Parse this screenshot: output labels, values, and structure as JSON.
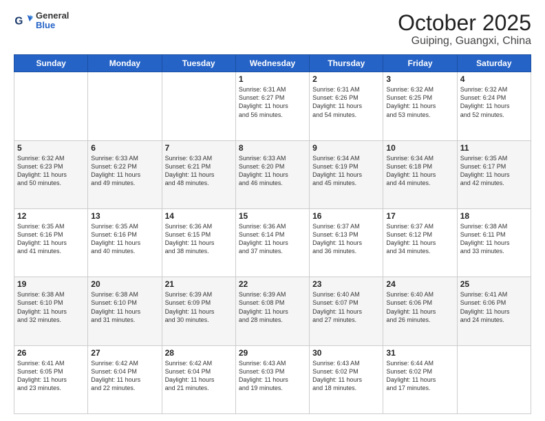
{
  "logo": {
    "line1": "General",
    "line2": "Blue"
  },
  "title": "October 2025",
  "subtitle": "Guiping, Guangxi, China",
  "days_of_week": [
    "Sunday",
    "Monday",
    "Tuesday",
    "Wednesday",
    "Thursday",
    "Friday",
    "Saturday"
  ],
  "weeks": [
    [
      {
        "day": "",
        "info": ""
      },
      {
        "day": "",
        "info": ""
      },
      {
        "day": "",
        "info": ""
      },
      {
        "day": "1",
        "info": "Sunrise: 6:31 AM\nSunset: 6:27 PM\nDaylight: 11 hours\nand 56 minutes."
      },
      {
        "day": "2",
        "info": "Sunrise: 6:31 AM\nSunset: 6:26 PM\nDaylight: 11 hours\nand 54 minutes."
      },
      {
        "day": "3",
        "info": "Sunrise: 6:32 AM\nSunset: 6:25 PM\nDaylight: 11 hours\nand 53 minutes."
      },
      {
        "day": "4",
        "info": "Sunrise: 6:32 AM\nSunset: 6:24 PM\nDaylight: 11 hours\nand 52 minutes."
      }
    ],
    [
      {
        "day": "5",
        "info": "Sunrise: 6:32 AM\nSunset: 6:23 PM\nDaylight: 11 hours\nand 50 minutes."
      },
      {
        "day": "6",
        "info": "Sunrise: 6:33 AM\nSunset: 6:22 PM\nDaylight: 11 hours\nand 49 minutes."
      },
      {
        "day": "7",
        "info": "Sunrise: 6:33 AM\nSunset: 6:21 PM\nDaylight: 11 hours\nand 48 minutes."
      },
      {
        "day": "8",
        "info": "Sunrise: 6:33 AM\nSunset: 6:20 PM\nDaylight: 11 hours\nand 46 minutes."
      },
      {
        "day": "9",
        "info": "Sunrise: 6:34 AM\nSunset: 6:19 PM\nDaylight: 11 hours\nand 45 minutes."
      },
      {
        "day": "10",
        "info": "Sunrise: 6:34 AM\nSunset: 6:18 PM\nDaylight: 11 hours\nand 44 minutes."
      },
      {
        "day": "11",
        "info": "Sunrise: 6:35 AM\nSunset: 6:17 PM\nDaylight: 11 hours\nand 42 minutes."
      }
    ],
    [
      {
        "day": "12",
        "info": "Sunrise: 6:35 AM\nSunset: 6:16 PM\nDaylight: 11 hours\nand 41 minutes."
      },
      {
        "day": "13",
        "info": "Sunrise: 6:35 AM\nSunset: 6:16 PM\nDaylight: 11 hours\nand 40 minutes."
      },
      {
        "day": "14",
        "info": "Sunrise: 6:36 AM\nSunset: 6:15 PM\nDaylight: 11 hours\nand 38 minutes."
      },
      {
        "day": "15",
        "info": "Sunrise: 6:36 AM\nSunset: 6:14 PM\nDaylight: 11 hours\nand 37 minutes."
      },
      {
        "day": "16",
        "info": "Sunrise: 6:37 AM\nSunset: 6:13 PM\nDaylight: 11 hours\nand 36 minutes."
      },
      {
        "day": "17",
        "info": "Sunrise: 6:37 AM\nSunset: 6:12 PM\nDaylight: 11 hours\nand 34 minutes."
      },
      {
        "day": "18",
        "info": "Sunrise: 6:38 AM\nSunset: 6:11 PM\nDaylight: 11 hours\nand 33 minutes."
      }
    ],
    [
      {
        "day": "19",
        "info": "Sunrise: 6:38 AM\nSunset: 6:10 PM\nDaylight: 11 hours\nand 32 minutes."
      },
      {
        "day": "20",
        "info": "Sunrise: 6:38 AM\nSunset: 6:10 PM\nDaylight: 11 hours\nand 31 minutes."
      },
      {
        "day": "21",
        "info": "Sunrise: 6:39 AM\nSunset: 6:09 PM\nDaylight: 11 hours\nand 30 minutes."
      },
      {
        "day": "22",
        "info": "Sunrise: 6:39 AM\nSunset: 6:08 PM\nDaylight: 11 hours\nand 28 minutes."
      },
      {
        "day": "23",
        "info": "Sunrise: 6:40 AM\nSunset: 6:07 PM\nDaylight: 11 hours\nand 27 minutes."
      },
      {
        "day": "24",
        "info": "Sunrise: 6:40 AM\nSunset: 6:06 PM\nDaylight: 11 hours\nand 26 minutes."
      },
      {
        "day": "25",
        "info": "Sunrise: 6:41 AM\nSunset: 6:06 PM\nDaylight: 11 hours\nand 24 minutes."
      }
    ],
    [
      {
        "day": "26",
        "info": "Sunrise: 6:41 AM\nSunset: 6:05 PM\nDaylight: 11 hours\nand 23 minutes."
      },
      {
        "day": "27",
        "info": "Sunrise: 6:42 AM\nSunset: 6:04 PM\nDaylight: 11 hours\nand 22 minutes."
      },
      {
        "day": "28",
        "info": "Sunrise: 6:42 AM\nSunset: 6:04 PM\nDaylight: 11 hours\nand 21 minutes."
      },
      {
        "day": "29",
        "info": "Sunrise: 6:43 AM\nSunset: 6:03 PM\nDaylight: 11 hours\nand 19 minutes."
      },
      {
        "day": "30",
        "info": "Sunrise: 6:43 AM\nSunset: 6:02 PM\nDaylight: 11 hours\nand 18 minutes."
      },
      {
        "day": "31",
        "info": "Sunrise: 6:44 AM\nSunset: 6:02 PM\nDaylight: 11 hours\nand 17 minutes."
      },
      {
        "day": "",
        "info": ""
      }
    ]
  ]
}
